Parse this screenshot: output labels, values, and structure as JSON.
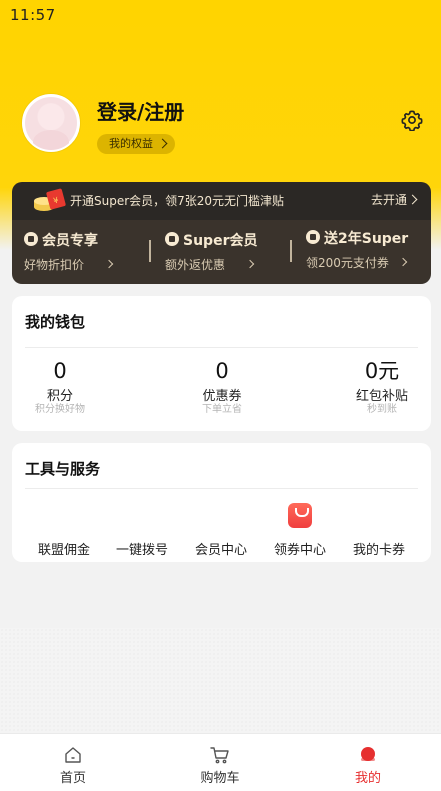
{
  "status_bar": {
    "time": "11:57"
  },
  "profile": {
    "login_label": "登录/注册",
    "rights_label": "我的权益"
  },
  "member_bar": {
    "promo": "开通Super会员，领7张20元无门槛津贴",
    "open_label": "去开通"
  },
  "benefits": [
    {
      "title": "会员专享",
      "sub": "好物折扣价"
    },
    {
      "title": "Super会员",
      "sub": "额外返优惠"
    },
    {
      "title": "送2年Super",
      "sub": "领200元支付券"
    }
  ],
  "wallet": {
    "title": "我的钱包",
    "items": [
      {
        "value": "0",
        "label": "积分",
        "sub": "积分换好物"
      },
      {
        "value": "0",
        "label": "优惠券",
        "sub": "下单立省"
      },
      {
        "value": "0元",
        "label": "红包补贴",
        "sub": "秒到账"
      }
    ]
  },
  "tools": {
    "title": "工具与服务",
    "items": [
      {
        "label": "联盟佣金"
      },
      {
        "label": "一键拨号"
      },
      {
        "label": "会员中心"
      },
      {
        "label": "领券中心",
        "icon": "coupon-bag-icon"
      },
      {
        "label": "我的卡券"
      }
    ]
  },
  "tabbar": {
    "items": [
      {
        "label": "首页",
        "icon": "home-icon"
      },
      {
        "label": "购物车",
        "icon": "cart-icon"
      },
      {
        "label": "我的",
        "icon": "profile-dot-icon",
        "active": true
      }
    ]
  },
  "colors": {
    "brand_yellow": "#ffd400",
    "member_dark": "#2b2825",
    "active_red": "#e62f2f"
  }
}
